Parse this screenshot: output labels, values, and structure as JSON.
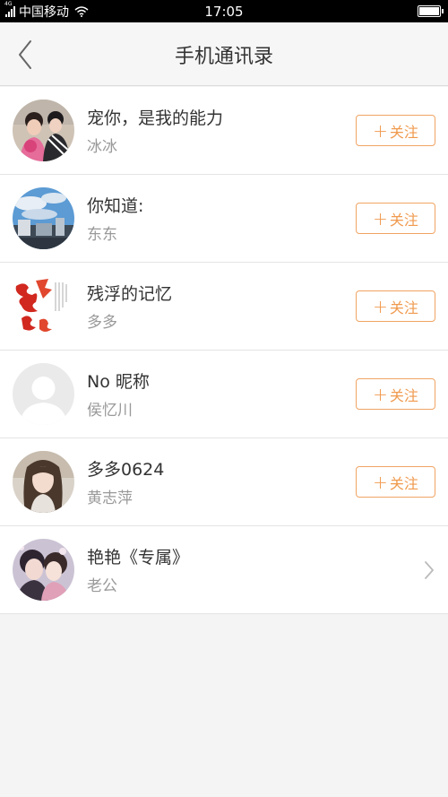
{
  "statusbar": {
    "net": "4G",
    "carrier": "中国移动",
    "time": "17:05"
  },
  "header": {
    "title": "手机通讯录"
  },
  "contacts": [
    {
      "name": "宠你，是我的能力",
      "sub": "冰冰",
      "action": "关注"
    },
    {
      "name": "你知道:",
      "sub": "东东",
      "action": "关注"
    },
    {
      "name": "残浮的记忆",
      "sub": "多多",
      "action": "关注"
    },
    {
      "name": "No 昵称",
      "sub": "侯忆川",
      "action": "关注"
    },
    {
      "name": "多多0624",
      "sub": "黄志萍",
      "action": "关注"
    },
    {
      "name": "艳艳《专属》",
      "sub": "老公",
      "action": ""
    }
  ],
  "colors": {
    "accent": "#f09a4e",
    "title": "#333333",
    "subtitle": "#999999"
  },
  "icons": {
    "back": "chevron-left-icon",
    "follow_plus": "plus-icon",
    "row_arrow": "chevron-right-icon"
  }
}
